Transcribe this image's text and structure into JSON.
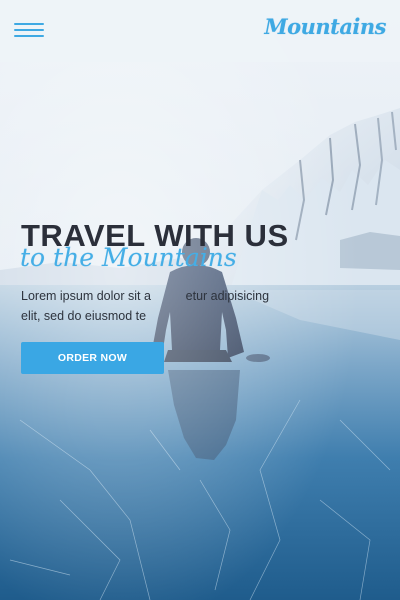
{
  "header": {
    "menu_icon": "hamburger-menu-icon",
    "logo_text": "Mountains",
    "accent_color": "#3fa9e3"
  },
  "hero": {
    "title": "TRAVEL WITH US",
    "script_subtitle": "to the Mountains",
    "body_line_1": "Lorem ipsum dolor sit a          etur adipisicing",
    "body_line_2": "elit, sed do eiusmod te",
    "cta_label": "ORDER NOW",
    "cta_color": "#3aa7e4"
  },
  "background": {
    "description_color_sky": "#e9eff5",
    "description_color_ice": "#2a6a9a"
  }
}
